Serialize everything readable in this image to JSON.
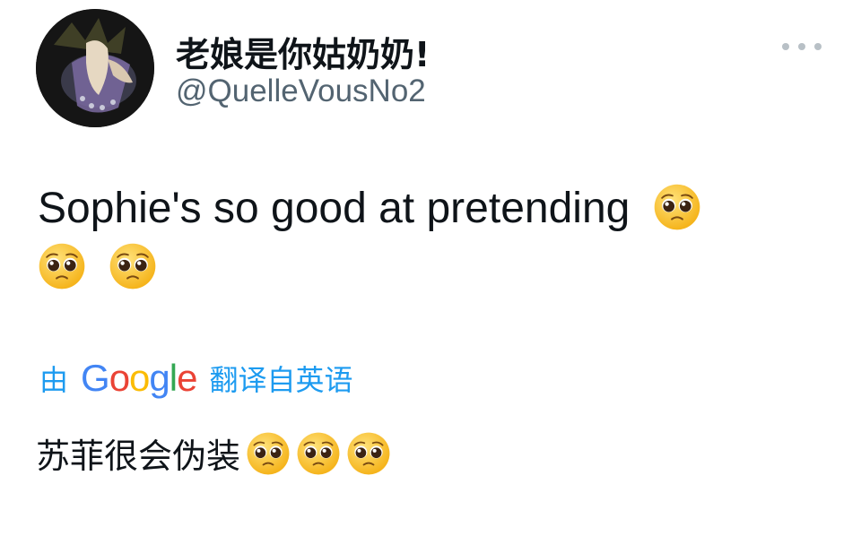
{
  "author": {
    "display_name": "老娘是你姑奶奶!",
    "handle": "@QuelleVousNo2"
  },
  "tweet": {
    "text": "Sophie's so good at pretending",
    "emoji": "pleading-face"
  },
  "translation": {
    "prefix": "由",
    "provider": "Google",
    "suffix": "翻译自英语",
    "text": "苏菲很会伪装"
  },
  "colors": {
    "link": "#1d9bf0",
    "secondary_text": "#536471",
    "primary_text": "#0f1419"
  },
  "icons": {
    "more": "more-options-icon",
    "emoji": "pleading-face-emoji"
  }
}
